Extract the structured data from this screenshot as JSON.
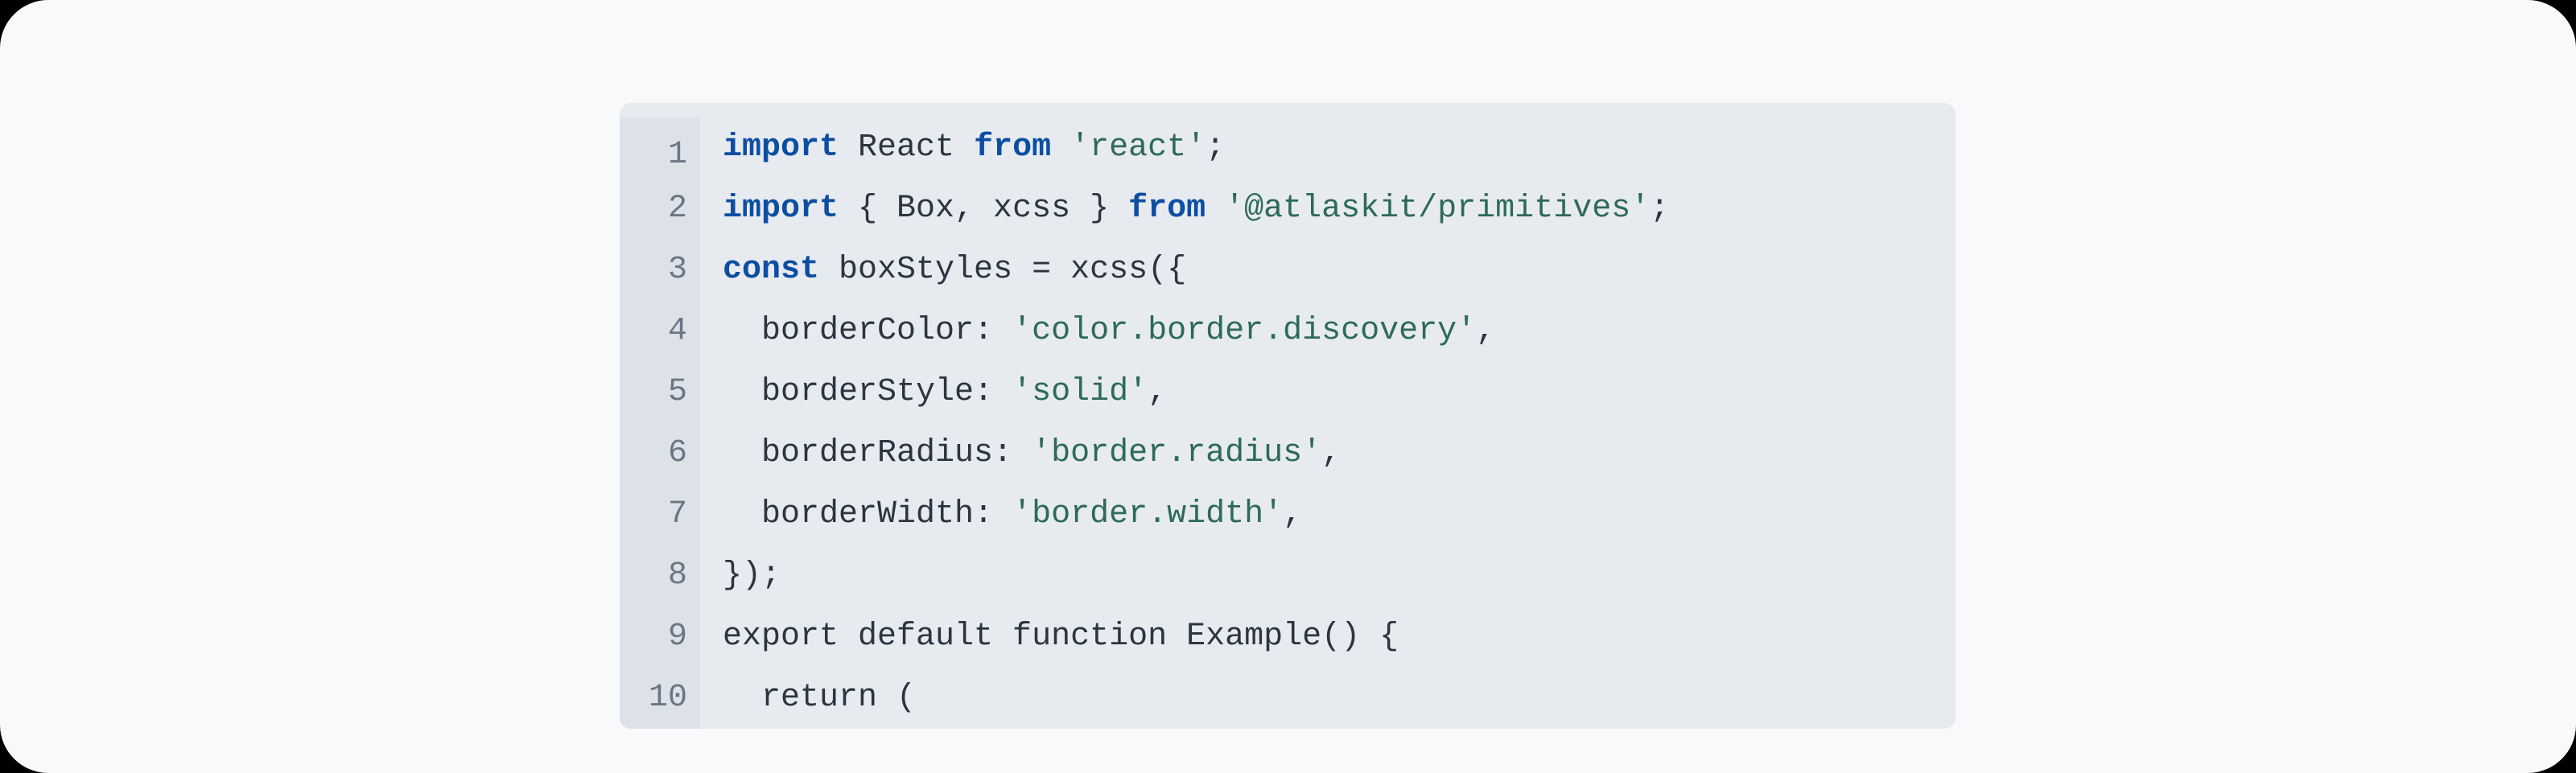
{
  "code": {
    "lines": [
      {
        "num": "1",
        "tokens": [
          {
            "t": "import ",
            "c": "kw"
          },
          {
            "t": "React ",
            "c": "txt"
          },
          {
            "t": "from ",
            "c": "kw"
          },
          {
            "t": "'react'",
            "c": "str"
          },
          {
            "t": ";",
            "c": "txt"
          }
        ]
      },
      {
        "num": "2",
        "tokens": [
          {
            "t": "import ",
            "c": "kw"
          },
          {
            "t": "{ Box, xcss } ",
            "c": "txt"
          },
          {
            "t": "from ",
            "c": "kw"
          },
          {
            "t": "'@atlaskit/primitives'",
            "c": "str"
          },
          {
            "t": ";",
            "c": "txt"
          }
        ]
      },
      {
        "num": "3",
        "tokens": [
          {
            "t": "const ",
            "c": "kw"
          },
          {
            "t": "boxStyles = xcss({",
            "c": "txt"
          }
        ]
      },
      {
        "num": "4",
        "tokens": [
          {
            "t": "  borderColor: ",
            "c": "txt"
          },
          {
            "t": "'color.border.discovery'",
            "c": "str"
          },
          {
            "t": ",",
            "c": "txt"
          }
        ]
      },
      {
        "num": "5",
        "tokens": [
          {
            "t": "  borderStyle: ",
            "c": "txt"
          },
          {
            "t": "'solid'",
            "c": "str"
          },
          {
            "t": ",",
            "c": "txt"
          }
        ]
      },
      {
        "num": "6",
        "tokens": [
          {
            "t": "  borderRadius: ",
            "c": "txt"
          },
          {
            "t": "'border.radius'",
            "c": "str"
          },
          {
            "t": ",",
            "c": "txt"
          }
        ]
      },
      {
        "num": "7",
        "tokens": [
          {
            "t": "  borderWidth: ",
            "c": "txt"
          },
          {
            "t": "'border.width'",
            "c": "str"
          },
          {
            "t": ",",
            "c": "txt"
          }
        ]
      },
      {
        "num": "8",
        "tokens": [
          {
            "t": "});",
            "c": "txt"
          }
        ]
      },
      {
        "num": "9",
        "tokens": [
          {
            "t": "export default function Example() {",
            "c": "txt"
          }
        ]
      },
      {
        "num": "10",
        "tokens": [
          {
            "t": "  return (",
            "c": "txt"
          }
        ]
      }
    ]
  }
}
